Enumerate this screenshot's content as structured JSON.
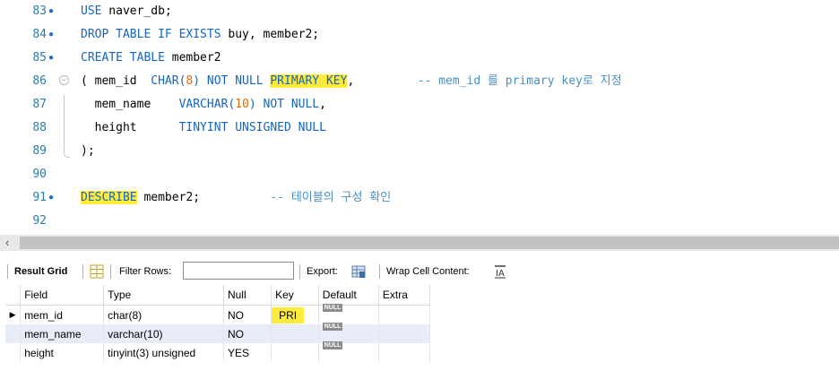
{
  "editor": {
    "lines": [
      {
        "num": "83",
        "marker": true,
        "parts": [
          {
            "t": "USE",
            "c": "kw"
          },
          {
            "t": " naver_db;",
            "c": ""
          }
        ]
      },
      {
        "num": "84",
        "marker": true,
        "parts": [
          {
            "t": "DROP TABLE IF EXISTS",
            "c": "kw"
          },
          {
            "t": " buy, member2;",
            "c": ""
          }
        ]
      },
      {
        "num": "85",
        "marker": true,
        "parts": [
          {
            "t": "CREATE TABLE",
            "c": "kw"
          },
          {
            "t": " member2",
            "c": ""
          }
        ]
      },
      {
        "num": "86",
        "marker": false,
        "fold": true,
        "parts": [
          {
            "t": "( mem_id  ",
            "c": ""
          },
          {
            "t": "CHAR(",
            "c": "kw"
          },
          {
            "t": "8",
            "c": "num"
          },
          {
            "t": ") NOT NULL ",
            "c": "kw"
          },
          {
            "t": "PRIMARY KEY",
            "c": "kw hl"
          },
          {
            "t": ",         ",
            "c": ""
          },
          {
            "t": "-- mem_id 를 primary key로 지정",
            "c": "cm"
          }
        ]
      },
      {
        "num": "87",
        "marker": false,
        "parts": [
          {
            "t": "  mem_name    ",
            "c": ""
          },
          {
            "t": "VARCHAR(",
            "c": "kw"
          },
          {
            "t": "10",
            "c": "num"
          },
          {
            "t": ") NOT NULL",
            "c": "kw"
          },
          {
            "t": ",",
            "c": ""
          }
        ]
      },
      {
        "num": "88",
        "marker": false,
        "parts": [
          {
            "t": "  height      ",
            "c": ""
          },
          {
            "t": "TINYINT UNSIGNED NULL",
            "c": "kw"
          }
        ]
      },
      {
        "num": "89",
        "marker": false,
        "parts": [
          {
            "t": ");",
            "c": ""
          }
        ]
      },
      {
        "num": "90",
        "marker": false,
        "parts": []
      },
      {
        "num": "91",
        "marker": true,
        "parts": [
          {
            "t": "DESCRIBE",
            "c": "kw hl"
          },
          {
            "t": " member2;          ",
            "c": ""
          },
          {
            "t": "-- 테이블의 구성 확인",
            "c": "cm"
          }
        ]
      },
      {
        "num": "92",
        "marker": false,
        "parts": []
      }
    ]
  },
  "toolbar": {
    "result_grid": "Result Grid",
    "filter_rows": "Filter Rows:",
    "filter_value": "",
    "export": "Export:",
    "wrap_cell": "Wrap Cell Content:"
  },
  "grid": {
    "columns": [
      "Field",
      "Type",
      "Null",
      "Key",
      "Default",
      "Extra"
    ],
    "rows": [
      {
        "Field": "mem_id",
        "Type": "char(8)",
        "Null": "NO",
        "Key": "PRI",
        "Default": "NULL",
        "Extra": "",
        "current": true
      },
      {
        "Field": "mem_name",
        "Type": "varchar(10)",
        "Null": "NO",
        "Key": "",
        "Default": "NULL",
        "Extra": "",
        "current": false
      },
      {
        "Field": "height",
        "Type": "tinyint(3) unsigned",
        "Null": "YES",
        "Key": "",
        "Default": "NULL",
        "Extra": "",
        "current": false
      }
    ]
  },
  "colors": {
    "keyword": "#1565c0",
    "comment": "#4a8fc4",
    "number": "#e56b00",
    "highlight": "#ffeb3b",
    "line_number": "#2b7ba8"
  }
}
